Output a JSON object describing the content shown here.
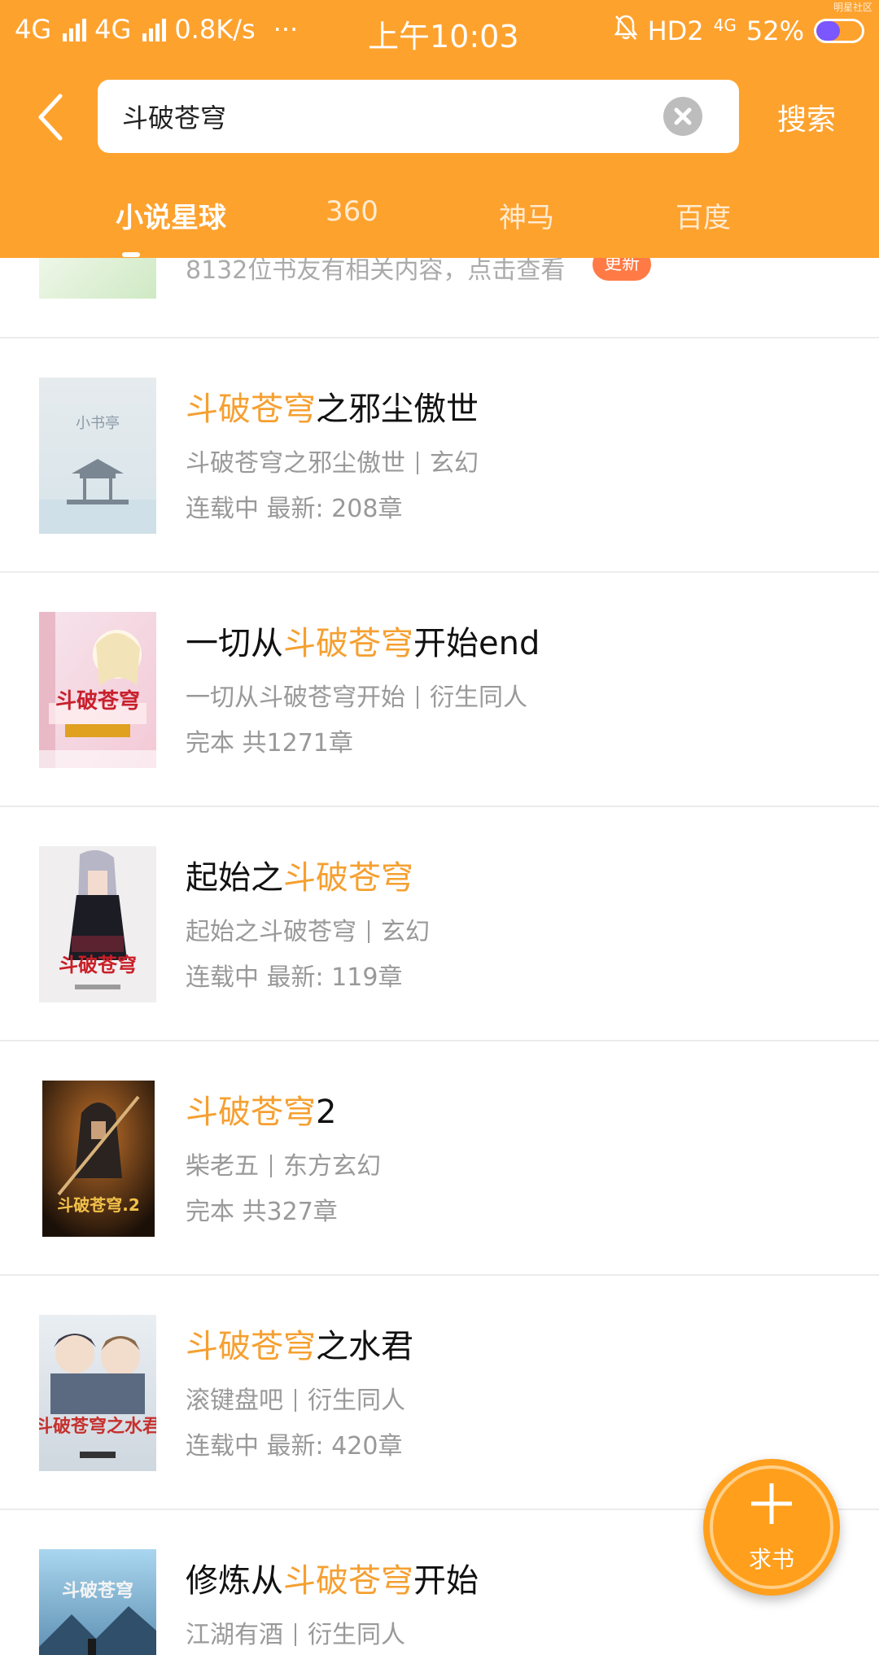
{
  "status_bar": {
    "network1": "4G",
    "network2": "4G",
    "speed": "0.8K/s",
    "dots": "···",
    "time": "上午10:03",
    "hd": "HD2",
    "net_small": "4G",
    "battery": "52%",
    "battery_level": 0.52,
    "corner_tag": "明星社区"
  },
  "search": {
    "query": "斗破苍穹",
    "button_label": "搜索"
  },
  "tabs": [
    {
      "label": "小说星球",
      "active": true
    },
    {
      "label": "360",
      "active": false
    },
    {
      "label": "神马",
      "active": false
    },
    {
      "label": "百度",
      "active": false
    }
  ],
  "partial_item": {
    "text": "8132位书友有相关内容，点击查看",
    "badge": "更新"
  },
  "books": [
    {
      "title_pre": "",
      "title_hl": "斗破苍穹",
      "title_post": "之邪尘傲世",
      "author": "斗破苍穹之邪尘傲世",
      "genre": "玄幻",
      "status": "连载中 最新: 208章",
      "cover_text": "小书亭"
    },
    {
      "title_pre": "一切从",
      "title_hl": "斗破苍穹",
      "title_post": "开始end",
      "author": "一切从斗破苍穹开始",
      "genre": "衍生同人",
      "status": "完本 共1271章",
      "cover_text": "斗破苍穹"
    },
    {
      "title_pre": "起始之",
      "title_hl": "斗破苍穹",
      "title_post": "",
      "author": "起始之斗破苍穹",
      "genre": "玄幻",
      "status": "连载中 最新: 119章",
      "cover_text": "斗破苍穹"
    },
    {
      "title_pre": "",
      "title_hl": "斗破苍穹",
      "title_post": "2",
      "author": "柴老五",
      "genre": "东方玄幻",
      "status": "完本 共327章",
      "cover_text": "斗破苍穹.2"
    },
    {
      "title_pre": "",
      "title_hl": "斗破苍穹",
      "title_post": "之水君",
      "author": "滚键盘吧",
      "genre": "衍生同人",
      "status": "连载中 最新: 420章",
      "cover_text": "斗破苍穹之水君"
    },
    {
      "title_pre": "修炼从",
      "title_hl": "斗破苍穹",
      "title_post": "开始",
      "author": "江湖有酒",
      "genre": "衍生同人",
      "status": "",
      "cover_text": "斗破苍穹"
    }
  ],
  "fab": {
    "label": "求书"
  },
  "colors": {
    "header": "#FEA22E",
    "highlight": "#F5A031",
    "fab": "#FF9F1C"
  }
}
